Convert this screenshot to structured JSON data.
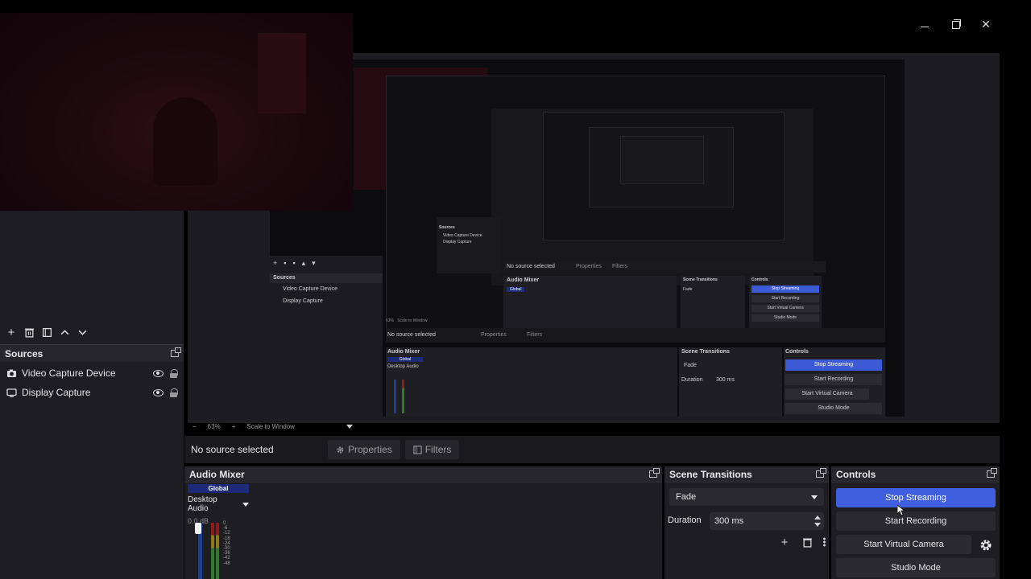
{
  "window": {
    "minimize_icon": "minimize-icon",
    "maximize_icon": "restore-icon",
    "close_icon": "close-icon",
    "close_glyph": "✕"
  },
  "sources": {
    "title": "Sources",
    "toolbar": [
      "add-icon",
      "trash-icon",
      "filter-icon",
      "arrow-up-icon",
      "arrow-down-icon"
    ],
    "items": [
      {
        "label": "Video Capture Device",
        "icon": "camera-icon"
      },
      {
        "label": "Display Capture",
        "icon": "monitor-icon"
      }
    ]
  },
  "zoom": {
    "minus": "−",
    "percent": "63%",
    "plus": "+",
    "mode": "Scale to Window"
  },
  "context": {
    "no_source": "No source selected",
    "properties": "Properties",
    "filters": "Filters"
  },
  "audio_mixer": {
    "title": "Audio Mixer",
    "global": "Global",
    "device": "Desktop Audio",
    "db": "0.0 dB",
    "ticks": [
      "0",
      "-6",
      "-12",
      "-18",
      "-24",
      "-30",
      "-36",
      "-42",
      "-48"
    ]
  },
  "scene_transitions": {
    "title": "Scene Transitions",
    "transition": "Fade",
    "duration_label": "Duration",
    "duration_value": "300 ms"
  },
  "controls": {
    "title": "Controls",
    "stop_streaming": "Stop Streaming",
    "start_recording": "Start Recording",
    "start_virtual_camera": "Start Virtual Camera",
    "studio_mode": "Studio Mode"
  },
  "mini": {
    "sources": "Sources",
    "video": "Video Capture Device",
    "display": "Display Capture",
    "no_source": "No source selected",
    "properties": "Properties",
    "filters": "Filters",
    "audio_mixer": "Audio Mixer",
    "global": "Global",
    "desktop_audio": "Desktop Audio",
    "scene_transitions": "Scene Transitions",
    "fade": "Fade",
    "duration": "Duration",
    "duration_value": "300 ms",
    "controls": "Controls",
    "stop_streaming": "Stop Streaming",
    "start_recording": "Start Recording",
    "start_virtual_camera": "Start Virtual Camera",
    "studio_mode": "Studio Mode",
    "zoom": "63%",
    "scale": "Scale to Window"
  },
  "colors": {
    "accent": "#3f5ee0",
    "global_badge": "#1c2a78",
    "panel": "#1e1e22",
    "header": "#27272b"
  }
}
